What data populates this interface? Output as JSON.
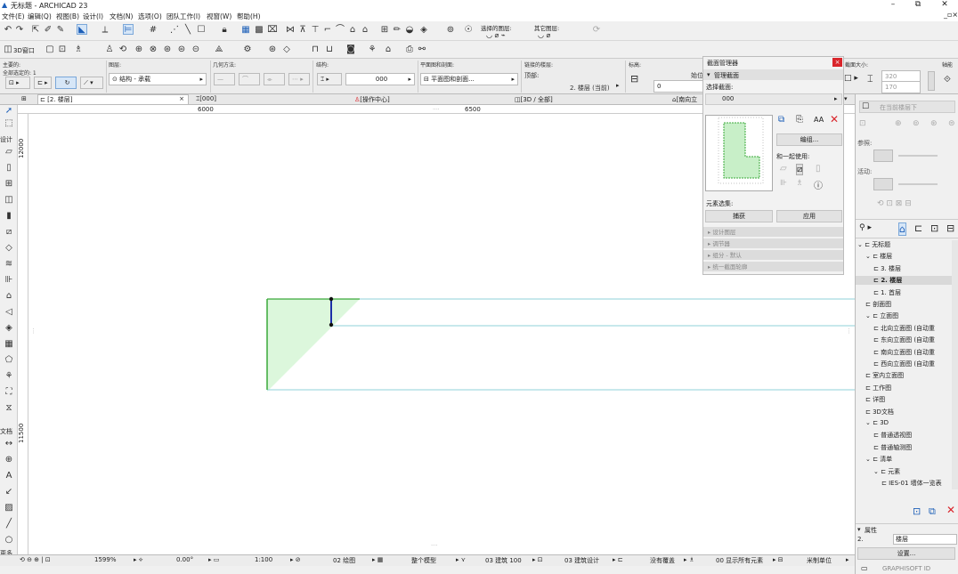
{
  "app": {
    "title": "无标题 - ARCHICAD 23",
    "minimize": "–",
    "restore": "⧉",
    "close": "✕"
  },
  "menu": [
    "文件(E)",
    "编辑(Q)",
    "视图(B)",
    "设计(I)",
    "文档(N)",
    "选项(O)",
    "团队工作(I)",
    "视窗(W)",
    "帮助(H)"
  ],
  "toolbar": {
    "layer_label1": "选择的图层:",
    "layer_label2": "其它图层:",
    "window3d": "3D窗口"
  },
  "infobox": {
    "main_label": "主要的:",
    "all_selected": "全部选定的: 1",
    "layer_label": "图层:",
    "layer_value": "结构 - 承载",
    "geometry_label": "几何方法:",
    "structure_label": "结构:",
    "structure_value": "000",
    "floorplan_label": "平面图和剖面:",
    "floorplan_value": "平面图和剖面...",
    "linked_floor_label": "链接的楼层:",
    "top_label": "顶部:",
    "top_value": "2. 楼层 (当前)",
    "elevation_label": "标高:",
    "elevation_value": "0",
    "start_label": "始位:",
    "section_size_label": "截面大小:",
    "size_w": "320",
    "size_h": "170",
    "axis_label": "轴能"
  },
  "tabs": [
    "[2. 楼层]",
    "[000]",
    "[操作中心]",
    "[3D / 全部]",
    "[南向立"
  ],
  "toolbox": {
    "design_label": "设计",
    "doc_label": "文档",
    "more_label": "更多"
  },
  "rulers": {
    "top_a": "6000",
    "top_b": "6500",
    "left_a": "12000",
    "left_b": "11500"
  },
  "section_manager": {
    "title": "截面管理器",
    "manage_header": "管理截面",
    "select_label": "选择截面:",
    "select_value": "000",
    "edit_btn": "编组...",
    "use_with": "和一起使用:",
    "element_select": "元素选集:",
    "pick_btn": "捕获",
    "apply_btn": "应用",
    "rows": [
      "设计图层",
      "调节器",
      "组分 - 默认",
      "统一截面轮廓"
    ],
    "aa_label": "AA"
  },
  "right_panel": {
    "floor_btn": "在当前楼层下",
    "ref_label": "参照:",
    "active_label": "活动:",
    "tree": [
      {
        "label": "无标题",
        "indent": 0,
        "caret": "⌄"
      },
      {
        "label": "楼层",
        "indent": 1,
        "caret": "⌄"
      },
      {
        "label": "3. 楼层",
        "indent": 2,
        "caret": ""
      },
      {
        "label": "2. 楼层",
        "indent": 2,
        "caret": "",
        "selected": true
      },
      {
        "label": "1. 首层",
        "indent": 2,
        "caret": ""
      },
      {
        "label": "剖面图",
        "indent": 1,
        "caret": ""
      },
      {
        "label": "立面图",
        "indent": 1,
        "caret": "⌄"
      },
      {
        "label": "北向立面图 (自动重",
        "indent": 2,
        "caret": ""
      },
      {
        "label": "东向立面图 (自动重",
        "indent": 2,
        "caret": ""
      },
      {
        "label": "南向立面图 (自动重",
        "indent": 2,
        "caret": ""
      },
      {
        "label": "西向立面图 (自动重",
        "indent": 2,
        "caret": ""
      },
      {
        "label": "室内立面图",
        "indent": 1,
        "caret": ""
      },
      {
        "label": "工作图",
        "indent": 1,
        "caret": ""
      },
      {
        "label": "详图",
        "indent": 1,
        "caret": ""
      },
      {
        "label": "3D文档",
        "indent": 1,
        "caret": ""
      },
      {
        "label": "3D",
        "indent": 1,
        "caret": "⌄"
      },
      {
        "label": "普通透视图",
        "indent": 2,
        "caret": ""
      },
      {
        "label": "普通轴测图",
        "indent": 2,
        "caret": ""
      },
      {
        "label": "清单",
        "indent": 1,
        "caret": "⌄"
      },
      {
        "label": "元素",
        "indent": 2,
        "caret": "⌄"
      },
      {
        "label": "IES-01 墙体一览表",
        "indent": 3,
        "caret": ""
      }
    ],
    "props_label": "属性",
    "props_floor_num": "2.",
    "props_floor_val": "楼层",
    "settings_btn": "设置...",
    "brand": "GRAPHISOFT ID"
  },
  "status": {
    "zoom": "1599%",
    "angle": "0.00°",
    "scale": "1:100",
    "pen": "02 绘图",
    "model": "整个模型",
    "arch": "03 建筑 100",
    "design": "03 建筑设计",
    "override": "没有覆盖",
    "show": "00 显示所有元素",
    "units": "米制单位"
  },
  "colors": {
    "accent": "#1d5fb8",
    "close_red": "#d9252b",
    "beam_green": "#3aa93a",
    "fill_green": "#dcf7dc",
    "cyan_line": "#8fd0d9"
  }
}
